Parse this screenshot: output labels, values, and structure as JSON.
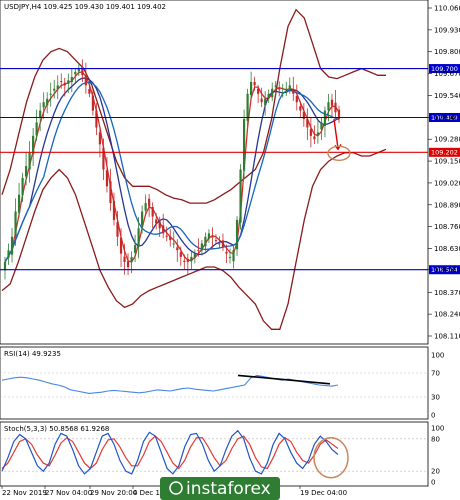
{
  "header": {
    "symbol_line": "USDJPY,H4  109.425 109.430 109.401 109.402"
  },
  "rsi_panel": {
    "label": "RSI(14) 49.9235"
  },
  "stoch_panel": {
    "label": "Stoch(5,3,3) 50.8568 61.9268"
  },
  "watermark": {
    "text": "instaforex"
  },
  "colors": {
    "candle_up": "#2e7d32",
    "candle_down": "#c62828",
    "bollinger": "#8b1a1a",
    "ma_fast": "#d32f2f",
    "ma_slow": "#1565c0",
    "ma_mid": "#283593",
    "level_blue": "#0000cc",
    "level_red": "#e00000",
    "rsi_line": "#4a86e8",
    "stoch_main": "#1e56c8",
    "stoch_signal": "#e53935",
    "annotation": "#c8865a",
    "watermark_bg": "#2e7d32"
  },
  "chart_data": [
    {
      "type": "candlestick",
      "title": "USDJPY,H4",
      "ylim": [
        108.11,
        110.06
      ],
      "y_ticks": [
        "110.060",
        "109.930",
        "109.800",
        "109.670",
        "109.540",
        "109.409",
        "109.280",
        "109.150",
        "109.020",
        "108.890",
        "108.760",
        "108.630",
        "108.504",
        "108.370",
        "108.240",
        "108.110"
      ],
      "x_ticks": [
        "22 Nov 2019",
        "27 Nov 04:00",
        "29 Nov 20:00",
        "4 Dec 12:00",
        "19 Dec 04:00"
      ],
      "levels": [
        {
          "value": 109.7,
          "label": "109.700",
          "color": "blue"
        },
        {
          "value": 109.409,
          "label": "109.409",
          "color": "blue"
        },
        {
          "value": 109.202,
          "label": "109.202",
          "color": "red"
        },
        {
          "value": 108.504,
          "label": "108.504",
          "color": "blue"
        }
      ],
      "close_series": [
        108.55,
        108.62,
        108.7,
        108.85,
        108.95,
        109.05,
        109.12,
        109.2,
        109.3,
        109.38,
        109.45,
        109.5,
        109.52,
        109.55,
        109.58,
        109.6,
        109.62,
        109.6,
        109.63,
        109.65,
        109.68,
        109.7,
        109.66,
        109.6,
        109.55,
        109.45,
        109.35,
        109.25,
        109.1,
        109.0,
        108.9,
        108.8,
        108.7,
        108.6,
        108.55,
        108.52,
        108.58,
        108.65,
        108.75,
        108.85,
        108.9,
        108.88,
        108.82,
        108.78,
        108.75,
        108.72,
        108.7,
        108.68,
        108.66,
        108.62,
        108.58,
        108.55,
        108.55,
        108.58,
        108.6,
        108.62,
        108.66,
        108.7,
        108.72,
        108.7,
        108.68,
        108.66,
        108.64,
        108.6,
        108.58,
        108.62,
        108.8,
        109.1,
        109.4,
        109.55,
        109.62,
        109.6,
        109.55,
        109.5,
        109.52,
        109.55,
        109.58,
        109.6,
        109.58,
        109.56,
        109.58,
        109.6,
        109.55,
        109.5,
        109.45,
        109.4,
        109.35,
        109.3,
        109.28,
        109.32,
        109.38,
        109.45,
        109.5,
        109.48,
        109.44,
        109.4
      ],
      "bollinger_upper": [
        108.95,
        109.1,
        109.3,
        109.5,
        109.65,
        109.75,
        109.8,
        109.82,
        109.8,
        109.75,
        109.7,
        109.6,
        109.45,
        109.3,
        109.15,
        109.05,
        109.0,
        109.0,
        109.0,
        108.98,
        108.95,
        108.93,
        108.92,
        108.9,
        108.9,
        108.9,
        108.92,
        108.95,
        108.98,
        109.02,
        109.06,
        109.1,
        109.2,
        109.4,
        109.7,
        109.95,
        110.05,
        110.0,
        109.85,
        109.7,
        109.65,
        109.64,
        109.66,
        109.68,
        109.7,
        109.68,
        109.66,
        109.66
      ],
      "bollinger_lower": [
        108.38,
        108.42,
        108.55,
        108.7,
        108.85,
        108.98,
        109.05,
        109.1,
        109.05,
        108.95,
        108.8,
        108.65,
        108.5,
        108.4,
        108.32,
        108.28,
        108.3,
        108.35,
        108.38,
        108.4,
        108.42,
        108.44,
        108.46,
        108.48,
        108.5,
        108.52,
        108.52,
        108.5,
        108.46,
        108.4,
        108.35,
        108.3,
        108.2,
        108.15,
        108.15,
        108.3,
        108.55,
        108.8,
        109.0,
        109.1,
        109.15,
        109.18,
        109.2,
        109.2,
        109.18,
        109.18,
        109.2,
        109.22
      ],
      "forecast_target": 109.202
    },
    {
      "type": "line",
      "title": "RSI(14) 49.9235",
      "ylim": [
        0,
        100
      ],
      "values": [
        58,
        60,
        62,
        63,
        62,
        60,
        58,
        55,
        52,
        50,
        47,
        42,
        40,
        38,
        36,
        37,
        38,
        40,
        41,
        40,
        39,
        38,
        37,
        38,
        40,
        42,
        41,
        40,
        42,
        44,
        45,
        43,
        42,
        41,
        40,
        42,
        44,
        46,
        48,
        50,
        62,
        66,
        64,
        62,
        60,
        58,
        60,
        58,
        56,
        54,
        52,
        50,
        49,
        48,
        50
      ],
      "trendline": {
        "from": 66,
        "to": 52
      }
    },
    {
      "type": "line",
      "title": "Stoch(5,3,3) 50.8568 61.9268",
      "ylim": [
        0,
        100
      ],
      "series": [
        {
          "values": [
            20,
            45,
            75,
            88,
            80,
            55,
            30,
            20,
            35,
            70,
            90,
            85,
            60,
            30,
            15,
            25,
            55,
            85,
            90,
            70,
            40,
            20,
            15,
            40,
            75,
            92,
            85,
            55,
            25,
            15,
            30,
            65,
            88,
            90,
            70,
            40,
            20,
            30,
            60,
            85,
            95,
            80,
            45,
            20,
            15,
            35,
            70,
            90,
            80,
            55,
            35,
            25,
            40,
            70,
            85,
            75,
            60,
            51
          ]
        },
        {
          "values": [
            25,
            35,
            55,
            75,
            80,
            70,
            50,
            35,
            30,
            50,
            72,
            82,
            75,
            55,
            35,
            25,
            35,
            60,
            78,
            80,
            65,
            45,
            30,
            30,
            50,
            75,
            85,
            75,
            55,
            35,
            25,
            40,
            65,
            82,
            82,
            65,
            45,
            30,
            40,
            62,
            80,
            85,
            70,
            45,
            28,
            25,
            45,
            70,
            82,
            75,
            55,
            40,
            35,
            50,
            70,
            78,
            70,
            62
          ]
        }
      ]
    }
  ]
}
